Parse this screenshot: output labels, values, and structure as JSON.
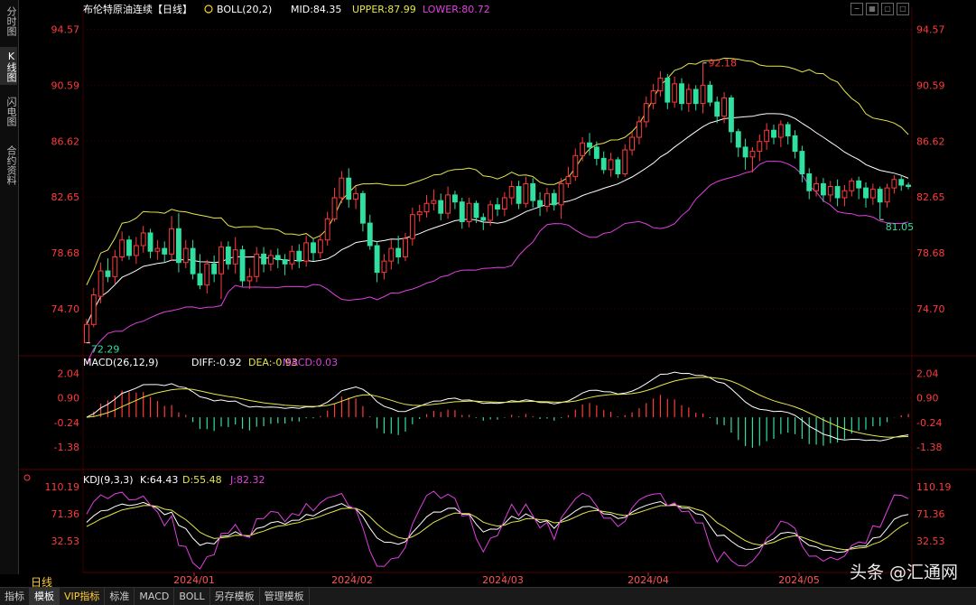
{
  "sidebar": {
    "tabs": [
      {
        "label": "分时图",
        "active": false
      },
      {
        "label": "K线图",
        "active": true
      },
      {
        "label": "闪电图",
        "active": false
      },
      {
        "label": "合约资料",
        "active": false
      }
    ]
  },
  "period_label": "日线",
  "bottom_tabs": [
    {
      "label": "指标",
      "active": false
    },
    {
      "label": "模板",
      "active": true
    },
    {
      "label": "VIP指标",
      "active": false
    },
    {
      "label": "标准",
      "active": false
    },
    {
      "label": "MACD",
      "active": false
    },
    {
      "label": "BOLL",
      "active": false
    },
    {
      "label": "另存模板",
      "active": false
    },
    {
      "label": "管理模板",
      "active": false
    }
  ],
  "watermark": "头条 @汇通网",
  "colors": {
    "up": "#ff3b3b",
    "down": "#2fe0a0",
    "mid": "#ffffff",
    "upper": "#e6e64a",
    "lower": "#e040e0",
    "axis_text": "#ff3b3b",
    "grid": "#3a0000"
  },
  "chart_data": [
    {
      "type": "candlestick",
      "panel": "main",
      "title": "布伦特原油连续【日线】",
      "indicator_labels": [
        "BOLL(20,2)",
        "MID:84.35",
        "UPPER:87.99",
        "LOWER:80.72"
      ],
      "y_ticks": [
        "94.57",
        "90.59",
        "86.62",
        "82.65",
        "78.68",
        "74.70"
      ],
      "ylim": [
        71.5,
        95.5
      ],
      "x_labels": [
        "2024/01",
        "2024/02",
        "2024/03",
        "2024/04",
        "2024/05"
      ],
      "annotations": {
        "high": "92.18",
        "low": "72.29",
        "recent_low": "81.05"
      },
      "candles": [
        [
          72.3,
          73.6,
          72.29,
          74.0
        ],
        [
          73.6,
          75.7,
          73.4,
          76.2
        ],
        [
          75.6,
          77.4,
          75.1,
          78.0
        ],
        [
          77.4,
          77.0,
          76.6,
          78.3
        ],
        [
          77.0,
          78.4,
          76.5,
          78.9
        ],
        [
          78.4,
          79.6,
          78.1,
          80.2
        ],
        [
          79.6,
          78.5,
          78.2,
          79.9
        ],
        [
          78.5,
          79.2,
          77.9,
          79.8
        ],
        [
          79.2,
          80.1,
          78.7,
          80.6
        ],
        [
          80.1,
          78.8,
          78.3,
          80.4
        ],
        [
          78.8,
          79.0,
          78.2,
          79.6
        ],
        [
          79.0,
          78.6,
          78.0,
          79.5
        ],
        [
          78.6,
          80.4,
          78.1,
          81.3
        ],
        [
          80.4,
          78.0,
          77.3,
          81.5
        ],
        [
          78.0,
          79.0,
          77.6,
          79.6
        ],
        [
          79.0,
          77.2,
          76.8,
          79.6
        ],
        [
          77.2,
          76.4,
          76.1,
          78.6
        ],
        [
          76.4,
          77.9,
          75.8,
          78.2
        ],
        [
          77.9,
          77.2,
          76.6,
          78.5
        ],
        [
          77.2,
          79.1,
          75.4,
          79.5
        ],
        [
          79.1,
          77.9,
          77.5,
          79.5
        ],
        [
          77.9,
          78.9,
          77.2,
          79.8
        ],
        [
          78.9,
          76.7,
          76.3,
          79.2
        ],
        [
          76.7,
          77.0,
          76.1,
          77.6
        ],
        [
          77.0,
          78.6,
          76.6,
          79.1
        ],
        [
          78.6,
          77.9,
          77.3,
          79.1
        ],
        [
          77.9,
          78.5,
          77.4,
          78.9
        ],
        [
          78.5,
          78.2,
          77.6,
          79.0
        ],
        [
          78.2,
          77.9,
          77.1,
          78.6
        ],
        [
          77.9,
          78.8,
          77.5,
          79.2
        ],
        [
          78.8,
          78.1,
          77.6,
          79.3
        ],
        [
          78.1,
          79.4,
          77.7,
          79.9
        ],
        [
          79.4,
          78.7,
          78.1,
          79.7
        ],
        [
          78.7,
          79.6,
          78.3,
          80.0
        ],
        [
          79.6,
          81.1,
          79.2,
          81.6
        ],
        [
          81.1,
          82.6,
          80.9,
          83.3
        ],
        [
          82.6,
          84.0,
          82.2,
          84.5
        ],
        [
          84.0,
          82.5,
          81.9,
          84.7
        ],
        [
          82.5,
          82.9,
          81.8,
          83.4
        ],
        [
          82.9,
          80.8,
          80.2,
          83.1
        ],
        [
          80.8,
          79.2,
          78.9,
          81.4
        ],
        [
          79.2,
          77.3,
          76.6,
          79.5
        ],
        [
          77.3,
          78.1,
          76.8,
          78.6
        ],
        [
          78.1,
          79.0,
          77.5,
          79.6
        ],
        [
          79.0,
          78.4,
          77.9,
          79.9
        ],
        [
          78.4,
          79.7,
          78.1,
          80.1
        ],
        [
          79.7,
          81.4,
          79.2,
          81.9
        ],
        [
          81.4,
          81.6,
          80.9,
          82.1
        ],
        [
          81.6,
          82.2,
          81.2,
          82.8
        ],
        [
          82.2,
          82.4,
          81.7,
          83.2
        ],
        [
          82.4,
          81.5,
          81.0,
          82.9
        ],
        [
          81.5,
          82.8,
          81.1,
          83.4
        ],
        [
          82.8,
          82.3,
          81.8,
          83.1
        ],
        [
          82.3,
          80.9,
          80.4,
          82.6
        ],
        [
          80.9,
          82.2,
          80.5,
          82.6
        ],
        [
          82.2,
          81.2,
          80.8,
          82.4
        ],
        [
          81.2,
          81.0,
          80.3,
          81.5
        ],
        [
          81.0,
          82.1,
          80.6,
          82.4
        ],
        [
          82.1,
          81.8,
          81.3,
          82.6
        ],
        [
          81.8,
          82.6,
          81.3,
          83.0
        ],
        [
          82.6,
          83.4,
          82.1,
          83.8
        ],
        [
          83.4,
          82.2,
          81.8,
          83.8
        ],
        [
          82.2,
          83.6,
          81.9,
          84.1
        ],
        [
          83.6,
          82.4,
          81.9,
          84.0
        ],
        [
          82.4,
          82.0,
          81.3,
          83.0
        ],
        [
          82.0,
          82.9,
          81.6,
          83.3
        ],
        [
          82.9,
          82.1,
          81.7,
          83.2
        ],
        [
          82.1,
          83.6,
          81.1,
          84.0
        ],
        [
          83.6,
          84.1,
          83.3,
          84.8
        ],
        [
          84.1,
          85.6,
          83.8,
          86.1
        ],
        [
          85.6,
          86.5,
          85.2,
          86.9
        ],
        [
          86.5,
          86.2,
          85.6,
          87.2
        ],
        [
          86.2,
          85.4,
          84.9,
          86.6
        ],
        [
          85.4,
          84.6,
          84.3,
          85.9
        ],
        [
          84.6,
          85.3,
          84.1,
          85.8
        ],
        [
          85.3,
          84.3,
          84.0,
          85.5
        ],
        [
          84.3,
          86.0,
          84.1,
          86.4
        ],
        [
          86.0,
          86.9,
          85.6,
          87.3
        ],
        [
          86.9,
          88.0,
          86.4,
          88.4
        ],
        [
          88.0,
          89.3,
          87.6,
          89.8
        ],
        [
          89.3,
          90.2,
          88.9,
          90.7
        ],
        [
          90.2,
          91.1,
          89.8,
          91.6
        ],
        [
          91.1,
          89.4,
          88.9,
          91.4
        ],
        [
          89.4,
          90.7,
          89.0,
          91.2
        ],
        [
          90.7,
          89.3,
          88.8,
          91.1
        ],
        [
          89.3,
          90.3,
          88.7,
          90.7
        ],
        [
          90.3,
          89.3,
          88.8,
          90.6
        ],
        [
          89.3,
          90.6,
          88.6,
          92.18
        ],
        [
          90.6,
          89.4,
          89.1,
          90.9
        ],
        [
          89.4,
          88.4,
          87.9,
          89.8
        ],
        [
          88.4,
          89.7,
          87.9,
          90.1
        ],
        [
          89.7,
          87.3,
          86.5,
          89.9
        ],
        [
          87.3,
          86.2,
          85.5,
          87.5
        ],
        [
          86.2,
          85.5,
          84.6,
          86.8
        ],
        [
          85.5,
          85.9,
          84.4,
          86.2
        ],
        [
          85.9,
          86.6,
          85.2,
          87.1
        ],
        [
          86.6,
          87.4,
          86.0,
          87.9
        ],
        [
          87.4,
          86.9,
          86.4,
          87.8
        ],
        [
          86.9,
          87.8,
          86.2,
          88.1
        ],
        [
          87.8,
          87.0,
          86.4,
          88.0
        ],
        [
          87.0,
          85.9,
          85.4,
          87.4
        ],
        [
          85.9,
          84.3,
          83.7,
          86.3
        ],
        [
          84.3,
          83.1,
          82.5,
          84.7
        ],
        [
          83.1,
          83.6,
          82.7,
          84.1
        ],
        [
          83.6,
          82.8,
          82.3,
          84.0
        ],
        [
          82.8,
          83.4,
          82.3,
          83.8
        ],
        [
          83.4,
          82.6,
          82.0,
          83.9
        ],
        [
          82.6,
          83.1,
          82.0,
          83.5
        ],
        [
          83.1,
          83.8,
          82.7,
          84.0
        ],
        [
          83.8,
          83.3,
          82.5,
          84.1
        ],
        [
          83.3,
          82.6,
          81.9,
          83.7
        ],
        [
          82.6,
          83.2,
          82.1,
          83.6
        ],
        [
          83.2,
          82.3,
          81.05,
          83.4
        ],
        [
          82.3,
          83.3,
          81.9,
          83.6
        ],
        [
          83.3,
          83.9,
          82.9,
          84.2
        ],
        [
          83.9,
          83.5,
          83.1,
          84.2
        ],
        [
          83.5,
          83.4,
          83.2,
          83.7
        ]
      ]
    },
    {
      "type": "bar+line",
      "panel": "macd",
      "title": "MACD(26,12,9)",
      "indicator_labels": [
        "DIFF:-0.92",
        "DEA:-0.93",
        "MACD:0.03"
      ],
      "y_ticks": [
        "2.04",
        "0.90",
        "-0.24",
        "-1.38"
      ],
      "ylim": [
        -2.1,
        2.4
      ]
    },
    {
      "type": "line",
      "panel": "kdj",
      "title": "KDJ(9,3,3)",
      "indicator_labels": [
        "K:64.43",
        "D:55.48",
        "J:82.32"
      ],
      "y_ticks": [
        "110.19",
        "71.36",
        "32.53"
      ],
      "ylim": [
        -8,
        118
      ]
    }
  ]
}
